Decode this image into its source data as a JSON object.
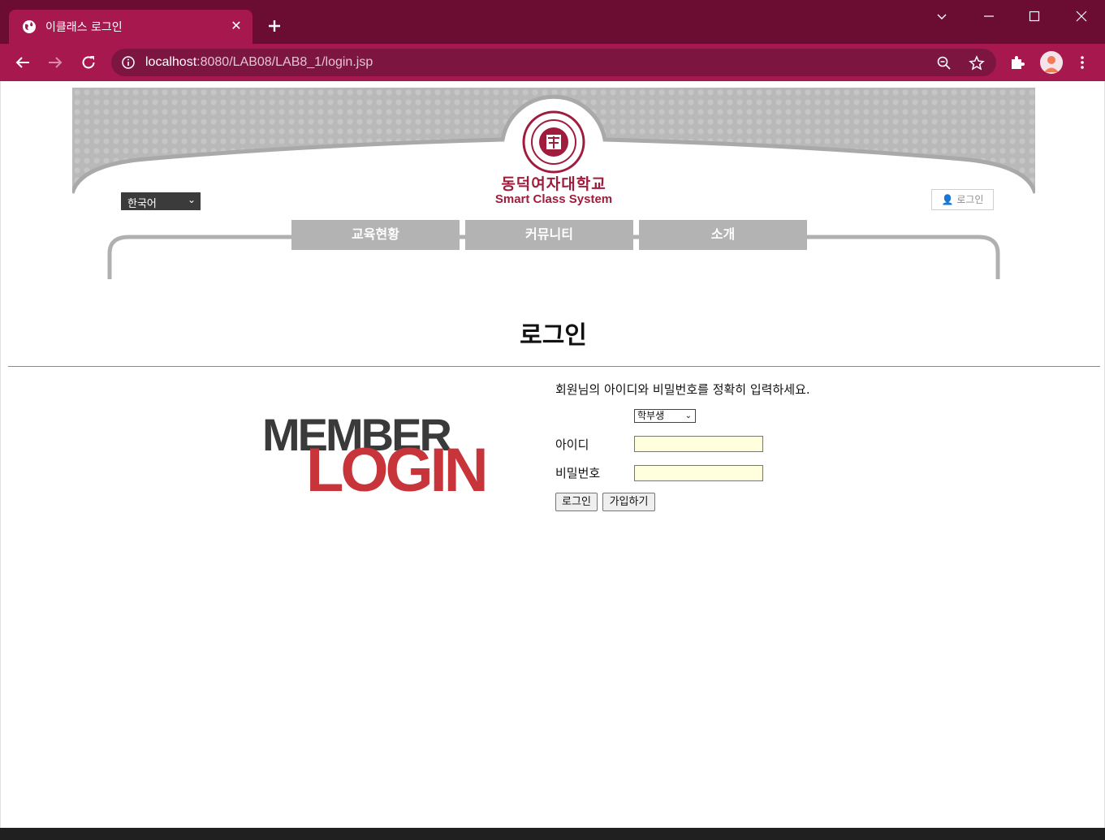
{
  "browser": {
    "tab_title": "이클래스 로그인",
    "url_host": "localhost",
    "url_path": ":8080/LAB08/LAB8_1/login.jsp"
  },
  "header": {
    "language_select": "한국어",
    "university_name": "동덕여자대학교",
    "system_name": "Smart Class System",
    "login_link": "로그인",
    "menu": [
      {
        "label": "교육현황"
      },
      {
        "label": "커뮤니티"
      },
      {
        "label": "소개"
      }
    ]
  },
  "main": {
    "title": "로그인",
    "logo_top": "MEMBER",
    "logo_bottom": "LOGIN",
    "instruction": "회원님의 아이디와 비밀번호를 정확히 입력하세요.",
    "user_type": "학부생",
    "id_label": "아이디",
    "password_label": "비밀번호",
    "login_button": "로그인",
    "signup_button": "가입하기"
  },
  "colors": {
    "chrome_titlebar": "#6b0c33",
    "chrome_toolbar": "#a7194e",
    "brand": "#a01c3c",
    "logo_red": "#c7343a",
    "logo_gray": "#3a3a3a"
  }
}
